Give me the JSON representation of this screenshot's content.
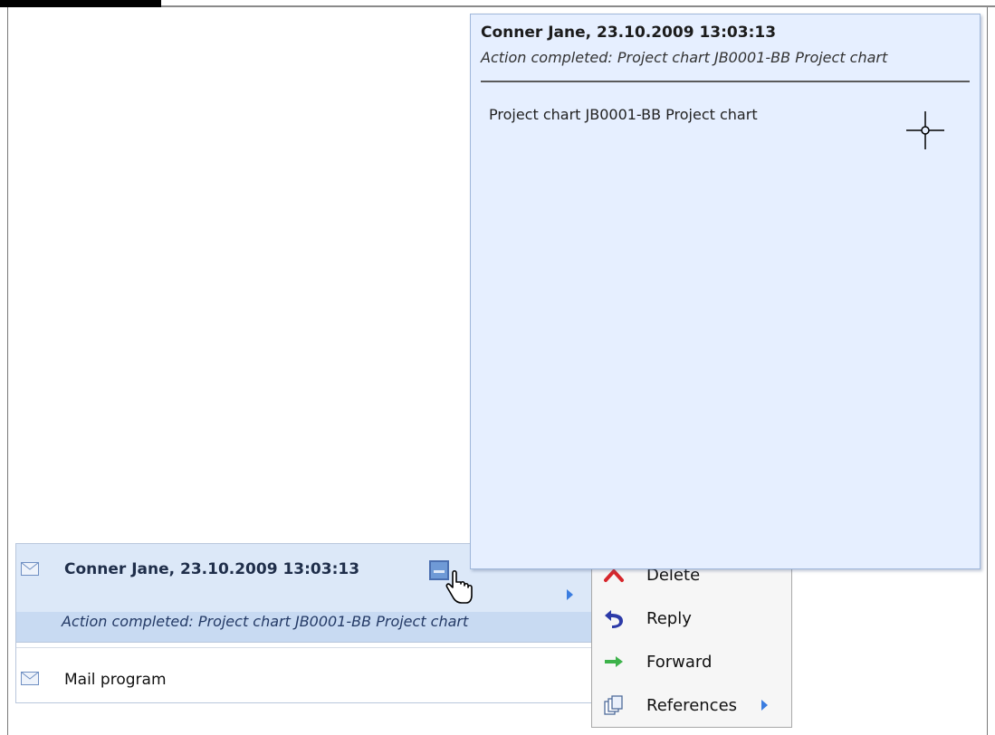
{
  "popup": {
    "title": "Conner Jane, 23.10.2009 13:03:13",
    "subtitle": "Action completed: Project chart JB0001-BB Project chart",
    "body": "Project chart JB0001-BB Project chart"
  },
  "messages": {
    "selected": {
      "title": "Conner Jane, 23.10.2009 13:03:13",
      "subtitle": "Action completed: Project chart JB0001-BB Project chart",
      "icon": "envelope-icon"
    },
    "second": {
      "label": "Mail program",
      "icon": "envelope-icon"
    }
  },
  "context_menu": {
    "items": [
      {
        "label": "Delete",
        "icon": "delete-icon"
      },
      {
        "label": "Reply",
        "icon": "reply-icon"
      },
      {
        "label": "Forward",
        "icon": "forward-icon"
      },
      {
        "label": "References",
        "icon": "references-icon",
        "has_submenu": true
      }
    ]
  },
  "colors": {
    "accent": "#3b7de0",
    "selection": "#dce8f8",
    "popup_bg": "#e6efff",
    "delete_red": "#d7262b",
    "reply_blue": "#2c3aa8",
    "forward_green": "#3db24a"
  }
}
